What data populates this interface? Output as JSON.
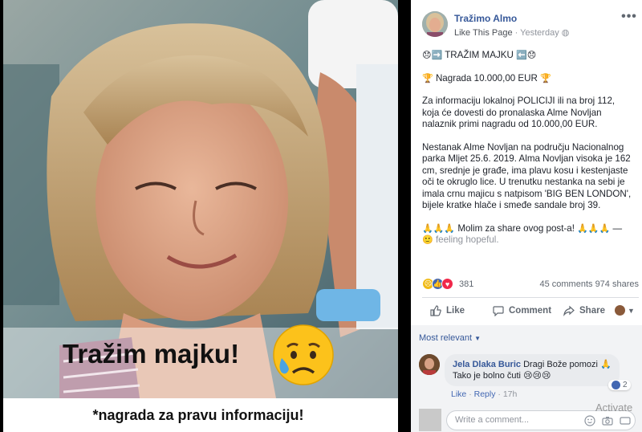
{
  "photo": {
    "headline": "Tražim majku!",
    "caption": "*nagrada za pravu informaciju!"
  },
  "post": {
    "page_name": "Tražimo Almo",
    "like_page": "Like This Page",
    "time": "Yesterday",
    "line1": "TRAŽIM MAJKU",
    "line2": "Nagrada 10.000,00 EUR",
    "para1": "Za informaciju lokalnoj POLICIJI ili na broj 112, koja će dovesti do pronalaska Alme Novljan nalaznik primi nagradu od 10.000,00 EUR.",
    "para2": "Nestanak Alme Novljan na području Nacionalnog parka Mljet 25.6. 2019. Alma Novljan visoka je 162 cm, srednje je građe, ima plavu kosu i kestenjaste oči te okruglo lice. U trenutku nestanka na sebi je imala crnu majicu s natpisom 'BIG BEN LONDON', bijele kratke hlače i smeđe sandale broj 39.",
    "share_line": "Molim za share ovog post-a!",
    "feeling": "feeling hopeful.",
    "reaction_count": "381",
    "comments_count": "45 comments",
    "shares_count": "974 shares"
  },
  "actions": {
    "like": "Like",
    "comment": "Comment",
    "share": "Share"
  },
  "comments": {
    "sort_label": "Most relevant",
    "items": [
      {
        "name": "Jela Dlaka Buric",
        "text_line1": "Dragi Bože pomozi",
        "text_line2": "Tako je bolno čuti",
        "like": "Like",
        "reply": "Reply",
        "time": "17h",
        "like_count": "2"
      }
    ],
    "input_placeholder": "Write a comment..."
  },
  "watermark": "Activate",
  "colors": {
    "fb_blue": "#365899",
    "like_blue": "#4267b2",
    "muted": "#90949c"
  }
}
